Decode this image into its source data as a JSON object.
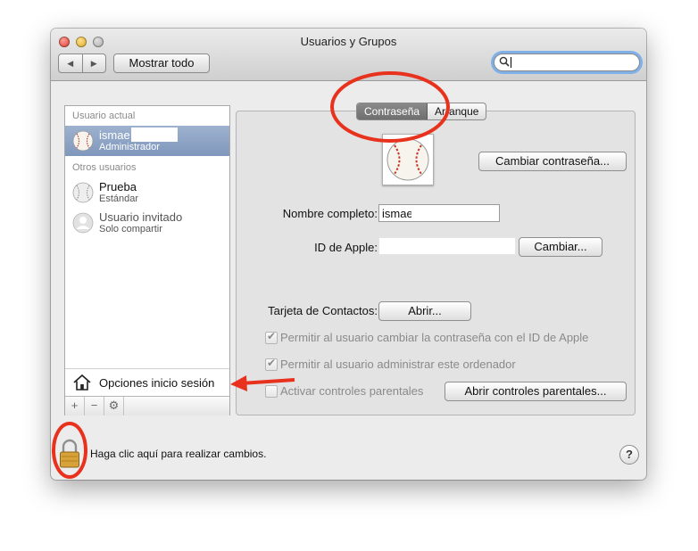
{
  "window": {
    "title": "Usuarios y Grupos"
  },
  "toolbar": {
    "back_glyph": "◀",
    "forward_glyph": "▶",
    "show_all_label": "Mostrar todo",
    "search_icon": "magnifier-icon"
  },
  "sidebar": {
    "current_user_header": "Usuario actual",
    "current_user": {
      "name": "ismae",
      "role": "Administrador",
      "avatar": "baseball-icon"
    },
    "other_users_header": "Otros usuarios",
    "other_users": [
      {
        "name": "Prueba",
        "role": "Estándar",
        "avatar": "baseball-icon"
      },
      {
        "name": "Usuario invitado",
        "role": "Solo compartir",
        "avatar": "guest-person-icon"
      }
    ],
    "login_options_label": "Opciones inicio sesión",
    "tool_add": "+",
    "tool_remove": "−",
    "tool_gear": "⚙"
  },
  "tabs": [
    {
      "label": "Contraseña",
      "active": true
    },
    {
      "label": "Arranque",
      "active": false
    }
  ],
  "main": {
    "change_password_button": "Cambiar contraseña...",
    "full_name_label": "Nombre completo:",
    "full_name_value": "ismae",
    "apple_id_label": "ID de Apple:",
    "apple_id_value": "",
    "apple_id_change_button": "Cambiar...",
    "contacts_label": "Tarjeta de Contactos:",
    "contacts_open_button": "Abrir...",
    "checkbox_reset_password": {
      "label": "Permitir al usuario cambiar la contraseña con el ID de Apple",
      "checked": true
    },
    "checkbox_admin": {
      "label": "Permitir al usuario administrar este ordenador",
      "checked": true
    },
    "checkbox_parental": {
      "label": "Activar controles parentales",
      "checked": false
    },
    "open_parental_button": "Abrir controles parentales..."
  },
  "footer": {
    "lock_text": "Haga clic aquí para realizar cambios.",
    "help_label": "?"
  },
  "annotation_color": "#e8321e"
}
